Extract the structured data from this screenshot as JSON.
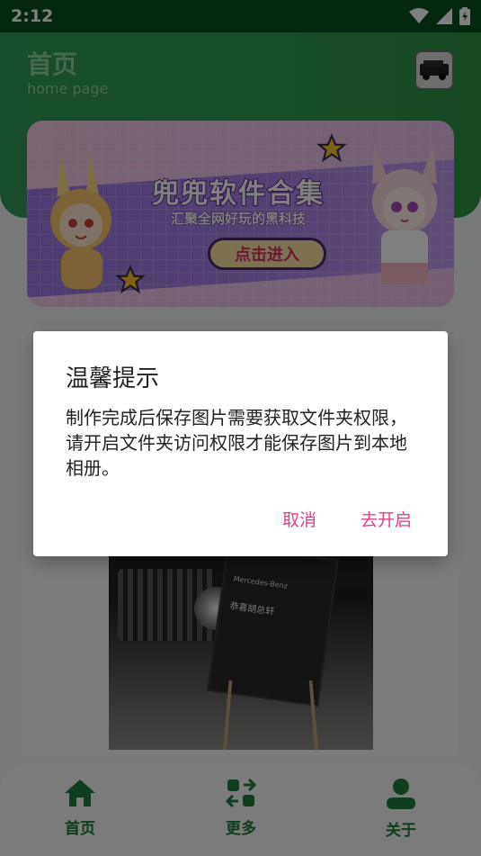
{
  "status_bar": {
    "time": "2:12"
  },
  "header": {
    "title": "首页",
    "subtitle": "home page"
  },
  "banner": {
    "title": "兜兜软件合集",
    "subtitle": "汇聚全网好玩的黑科技",
    "button_label": "点击进入"
  },
  "photo": {
    "brand_text": "Mercedes-Benz",
    "board_heading": "恭喜胡总轩"
  },
  "bottom_nav": {
    "items": [
      {
        "label": "首页",
        "icon": "home-icon"
      },
      {
        "label": "更多",
        "icon": "grid-icon"
      },
      {
        "label": "关于",
        "icon": "user-icon"
      }
    ]
  },
  "dialog": {
    "title": "温馨提示",
    "message": "制作完成后保存图片需要获取文件夹权限，请开启文件夹访问权限才能保存图片到本地相册。",
    "cancel_label": "取消",
    "confirm_label": "去开启"
  },
  "colors": {
    "accent_pink": "#e0408a",
    "brand_green": "#2f9a52",
    "nav_green": "#1e7a3a"
  }
}
